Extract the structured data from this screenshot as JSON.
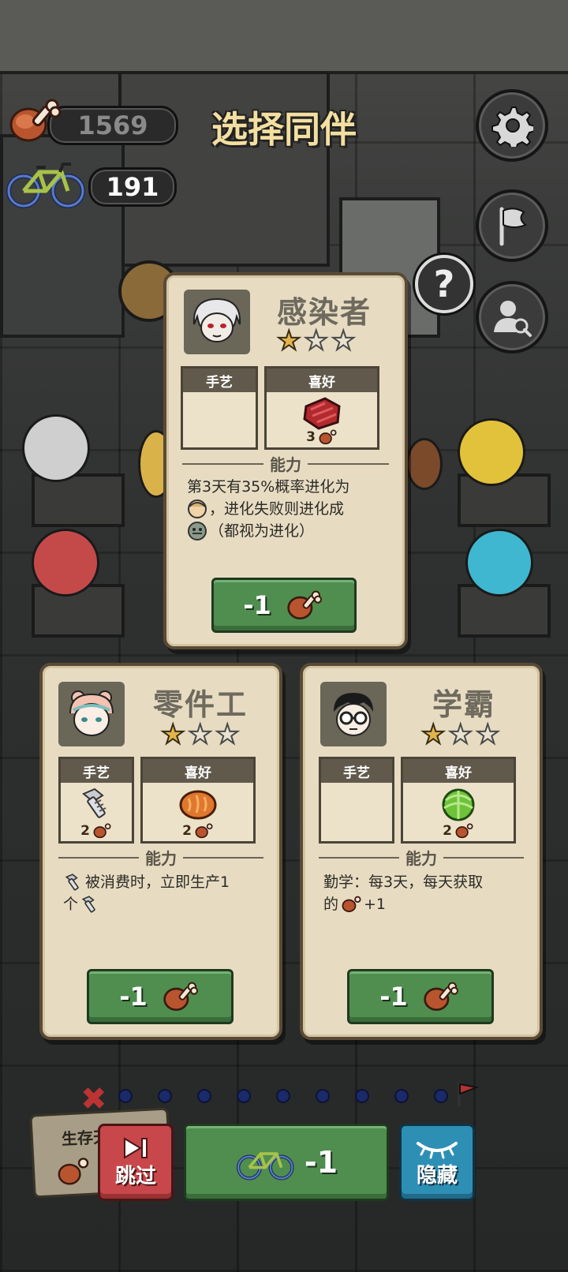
{
  "hud": {
    "meat_count": "1569",
    "bike_count": "191",
    "title": "选择同伴"
  },
  "cards": [
    {
      "name": "感染者",
      "stars_filled": 1,
      "stars_total": 3,
      "craft_label": "手艺",
      "like_label": "喜好",
      "like_item": "raw-meat-icon",
      "like_cost": "3",
      "ability_label": "能力",
      "desc_line1": "第3天有35%概率进化为",
      "desc_line2": "，进化失败则进化成",
      "desc_line3": "（都视为进化）",
      "button_label": "-1"
    },
    {
      "name": "零件工",
      "stars_filled": 1,
      "stars_total": 3,
      "craft_label": "手艺",
      "craft_item": "bolt-icon",
      "craft_cost": "2",
      "like_label": "喜好",
      "like_item": "bread-icon",
      "like_cost": "2",
      "ability_label": "能力",
      "desc_line1": "被消费时，立即生产1",
      "desc_line2": "个",
      "button_label": "-1"
    },
    {
      "name": "学霸",
      "stars_filled": 1,
      "stars_total": 3,
      "craft_label": "手艺",
      "like_label": "喜好",
      "like_item": "cabbage-icon",
      "like_cost": "2",
      "ability_label": "能力",
      "desc_line1": "勤学：每3天，每天获取",
      "desc_line2a": "的",
      "desc_line2b": "+1",
      "button_label": "-1"
    }
  ],
  "bottom": {
    "survival_label": "生存天数",
    "skip_label": "跳过",
    "refresh_label": "-1",
    "hide_label": "隐藏"
  },
  "colors": {
    "accent_green": "#4f8e4f",
    "skip_red": "#c8474a",
    "hide_blue": "#2e8fb5",
    "title_gold": "#f3dfa0",
    "card_bg": "#e7dcc2"
  }
}
